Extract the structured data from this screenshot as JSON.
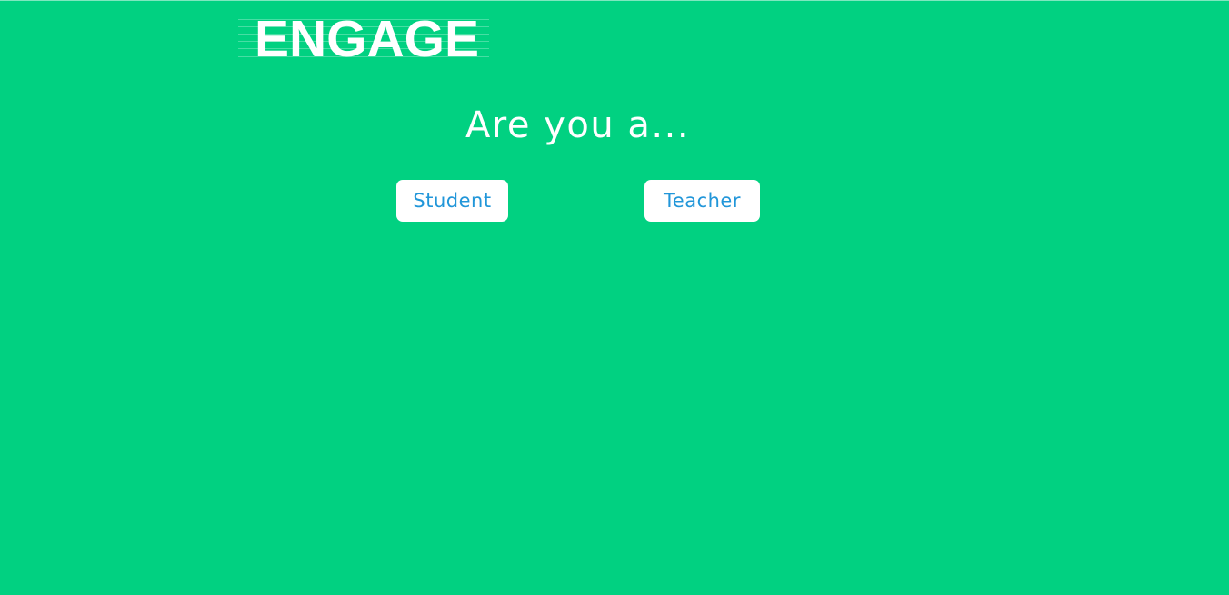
{
  "brand": {
    "logo_text": "ENGAGE"
  },
  "main": {
    "prompt": "Are you a...",
    "buttons": {
      "student_label": "Student",
      "teacher_label": "Teacher"
    }
  },
  "colors": {
    "background": "#01d181",
    "button_background": "#ffffff",
    "button_text": "#2196d9",
    "text": "#ffffff"
  }
}
